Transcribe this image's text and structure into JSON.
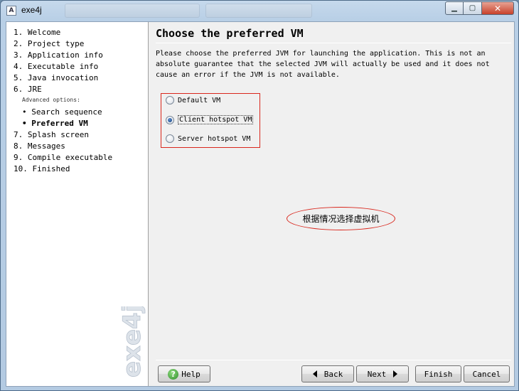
{
  "window": {
    "title": "exe4j",
    "icon": "app-icon"
  },
  "sidebar": {
    "steps": [
      {
        "label": "1. Welcome"
      },
      {
        "label": "2. Project type"
      },
      {
        "label": "3. Application info"
      },
      {
        "label": "4. Executable info"
      },
      {
        "label": "5. Java invocation"
      },
      {
        "label": "6. JRE"
      }
    ],
    "advanced_label": "Advanced options:",
    "sub_steps": [
      {
        "label": "• Search sequence"
      },
      {
        "label": "• Preferred VM",
        "current": true
      }
    ],
    "more_steps": [
      {
        "label": "7. Splash screen"
      },
      {
        "label": "8. Messages"
      },
      {
        "label": "9. Compile executable"
      },
      {
        "label": "10. Finished"
      }
    ],
    "watermark": "exe4j"
  },
  "main": {
    "title": "Choose the preferred VM",
    "description_lines": [
      "Please choose the preferred JVM for launching the application. This is not an",
      "absolute guarantee that the selected JVM will actually be used and it does not",
      "cause an error if the JVM is not available."
    ],
    "vm_options": [
      {
        "label": "Default VM",
        "checked": false
      },
      {
        "label": "Client hotspot VM",
        "checked": true
      },
      {
        "label": "Server hotspot VM",
        "checked": false
      }
    ],
    "annotation": "根据情况选择虚拟机",
    "annotation_color": "#d9261c"
  },
  "buttons": {
    "help": "Help",
    "back": "Back",
    "next": "Next",
    "finish": "Finish",
    "cancel": "Cancel"
  }
}
